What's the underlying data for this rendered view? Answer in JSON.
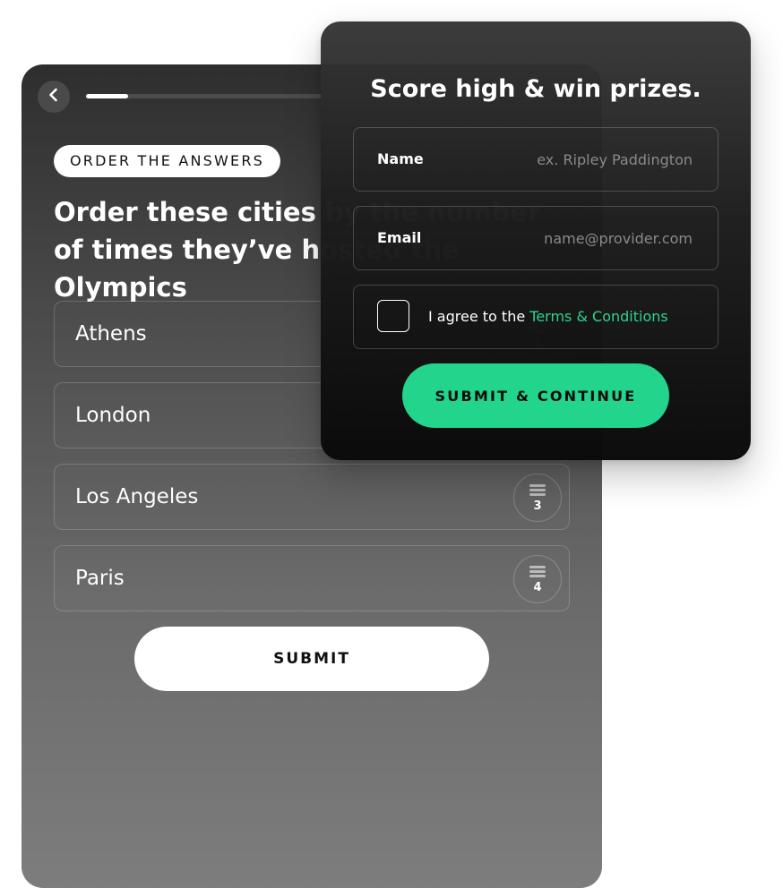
{
  "quiz": {
    "progress": 0.09,
    "badge": "ORDER THE ANSWERS",
    "question": "Order these cities by the number of times they’ve hosted the Olympics",
    "answers": [
      {
        "label": "Athens",
        "rank": "1"
      },
      {
        "label": "London",
        "rank": "2"
      },
      {
        "label": "Los Angeles",
        "rank": "3"
      },
      {
        "label": "Paris",
        "rank": "4"
      }
    ],
    "submit_label": "SUBMIT"
  },
  "modal": {
    "title": "Score high & win prizes.",
    "name_label": "Name",
    "name_placeholder": "ex. Ripley Paddington",
    "email_label": "Email",
    "email_placeholder": "name@provider.com",
    "terms_prefix": "I agree to the ",
    "terms_link": "Terms & Conditions",
    "continue_label": "SUBMIT & CONTINUE"
  },
  "colors": {
    "accent": "#22d48c",
    "link": "#2ed38e",
    "modal_bg": "#0a0a0a"
  },
  "icons": {
    "back": "chevron-left-icon",
    "drag": "drag-handle-icon"
  }
}
